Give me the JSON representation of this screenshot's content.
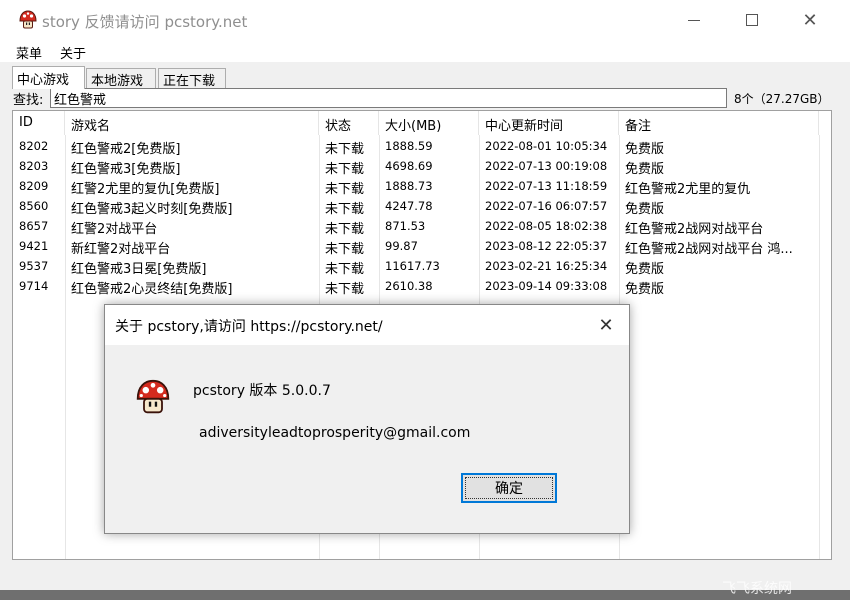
{
  "window": {
    "title": "story 反馈请访问 pcstory.net",
    "menu": [
      "菜单",
      "关于"
    ]
  },
  "tabs": [
    "中心游戏",
    "本地游戏",
    "正在下载"
  ],
  "search": {
    "label": "查找:",
    "value": "红色警戒",
    "result_count": "8个（27.27GB）"
  },
  "table": {
    "columns": [
      "ID",
      "游戏名",
      "状态",
      "大小(MB)",
      "中心更新时间",
      "备注"
    ],
    "rows": [
      {
        "id": "8202",
        "name": "红色警戒2[免费版]",
        "status": "未下载",
        "size": "1888.59",
        "updated": "2022-08-01 10:05:34",
        "note": "免费版"
      },
      {
        "id": "8203",
        "name": "红色警戒3[免费版]",
        "status": "未下载",
        "size": "4698.69",
        "updated": "2022-07-13 00:19:08",
        "note": "免费版"
      },
      {
        "id": "8209",
        "name": "红警2尤里的复仇[免费版]",
        "status": "未下载",
        "size": "1888.73",
        "updated": "2022-07-13 11:18:59",
        "note": "红色警戒2尤里的复仇"
      },
      {
        "id": "8560",
        "name": "红色警戒3起义时刻[免费版]",
        "status": "未下载",
        "size": "4247.78",
        "updated": "2022-07-16 06:07:57",
        "note": "免费版"
      },
      {
        "id": "8657",
        "name": "红警2对战平台",
        "status": "未下载",
        "size": "871.53",
        "updated": "2022-08-05 18:02:38",
        "note": "红色警戒2战网对战平台"
      },
      {
        "id": "9421",
        "name": "新红警2对战平台",
        "status": "未下载",
        "size": "99.87",
        "updated": "2023-08-12 22:05:37",
        "note": "红色警戒2战网对战平台 鸿..."
      },
      {
        "id": "9537",
        "name": "红色警戒3日冕[免费版]",
        "status": "未下载",
        "size": "11617.73",
        "updated": "2023-02-21 16:25:34",
        "note": "免费版"
      },
      {
        "id": "9714",
        "name": "红色警戒2心灵终结[免费版]",
        "status": "未下载",
        "size": "2610.38",
        "updated": "2023-09-14 09:33:08",
        "note": "免费版"
      }
    ]
  },
  "dialog": {
    "title": "关于 pcstory,请访问 https://pcstory.net/",
    "version": "pcstory  版本 5.0.0.7",
    "email": "adiversityleadtoprosperity@gmail.com",
    "ok_label": "确定"
  },
  "watermark": "飞飞系统网",
  "colors": {
    "accent": "#0078d7",
    "mushroom_red": "#d42a1e"
  },
  "icons": {
    "app": "mushroom-icon",
    "close": "close-icon",
    "minimize": "minimize-icon",
    "maximize": "maximize-icon"
  }
}
